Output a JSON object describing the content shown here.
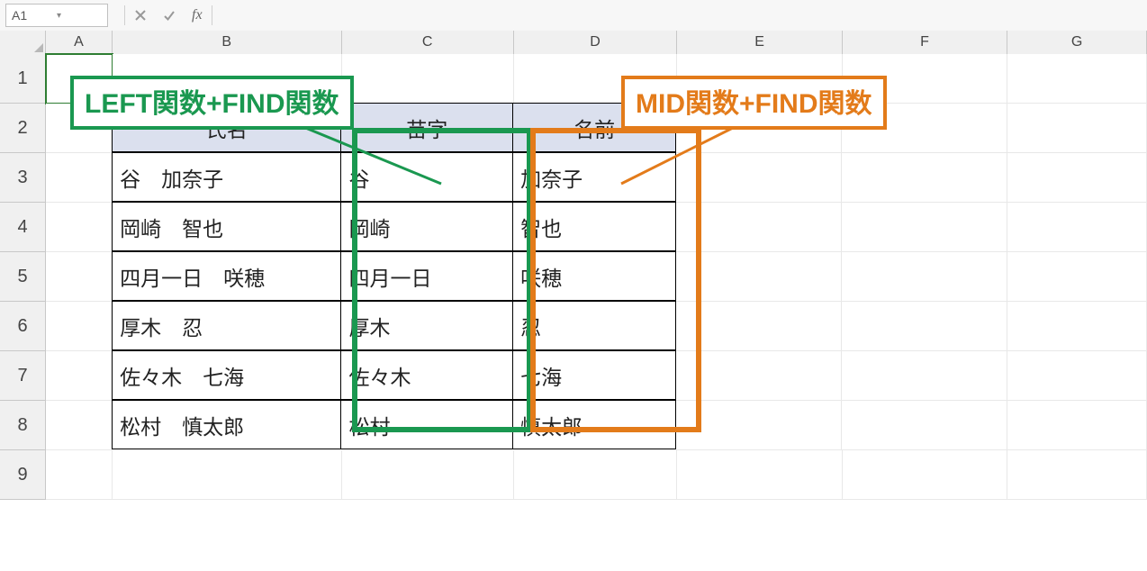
{
  "formula_bar": {
    "name_box": "A1",
    "fx_label": "fx",
    "formula_value": ""
  },
  "columns": [
    "A",
    "B",
    "C",
    "D",
    "E",
    "F",
    "G"
  ],
  "row_numbers": [
    "1",
    "2",
    "3",
    "4",
    "5",
    "6",
    "7",
    "8",
    "9"
  ],
  "table": {
    "headers": {
      "b": "氏名",
      "c": "苗字",
      "d": "名前"
    },
    "rows": [
      {
        "b": "谷　加奈子",
        "c": "谷",
        "d": "加奈子"
      },
      {
        "b": "岡崎　智也",
        "c": "岡崎",
        "d": "智也"
      },
      {
        "b": "四月一日　咲穂",
        "c": "四月一日",
        "d": "咲穂"
      },
      {
        "b": "厚木　忍",
        "c": "厚木",
        "d": "忍"
      },
      {
        "b": "佐々木　七海",
        "c": "佐々木",
        "d": "七海"
      },
      {
        "b": "松村　慎太郎",
        "c": "松村",
        "d": "慎太郎"
      }
    ]
  },
  "callouts": {
    "left_find": "LEFT関数+FIND関数",
    "mid_find": "MID関数+FIND関数"
  },
  "colors": {
    "green": "#1a9850",
    "orange": "#e37b1a",
    "header_fill": "#dbe0ee"
  }
}
